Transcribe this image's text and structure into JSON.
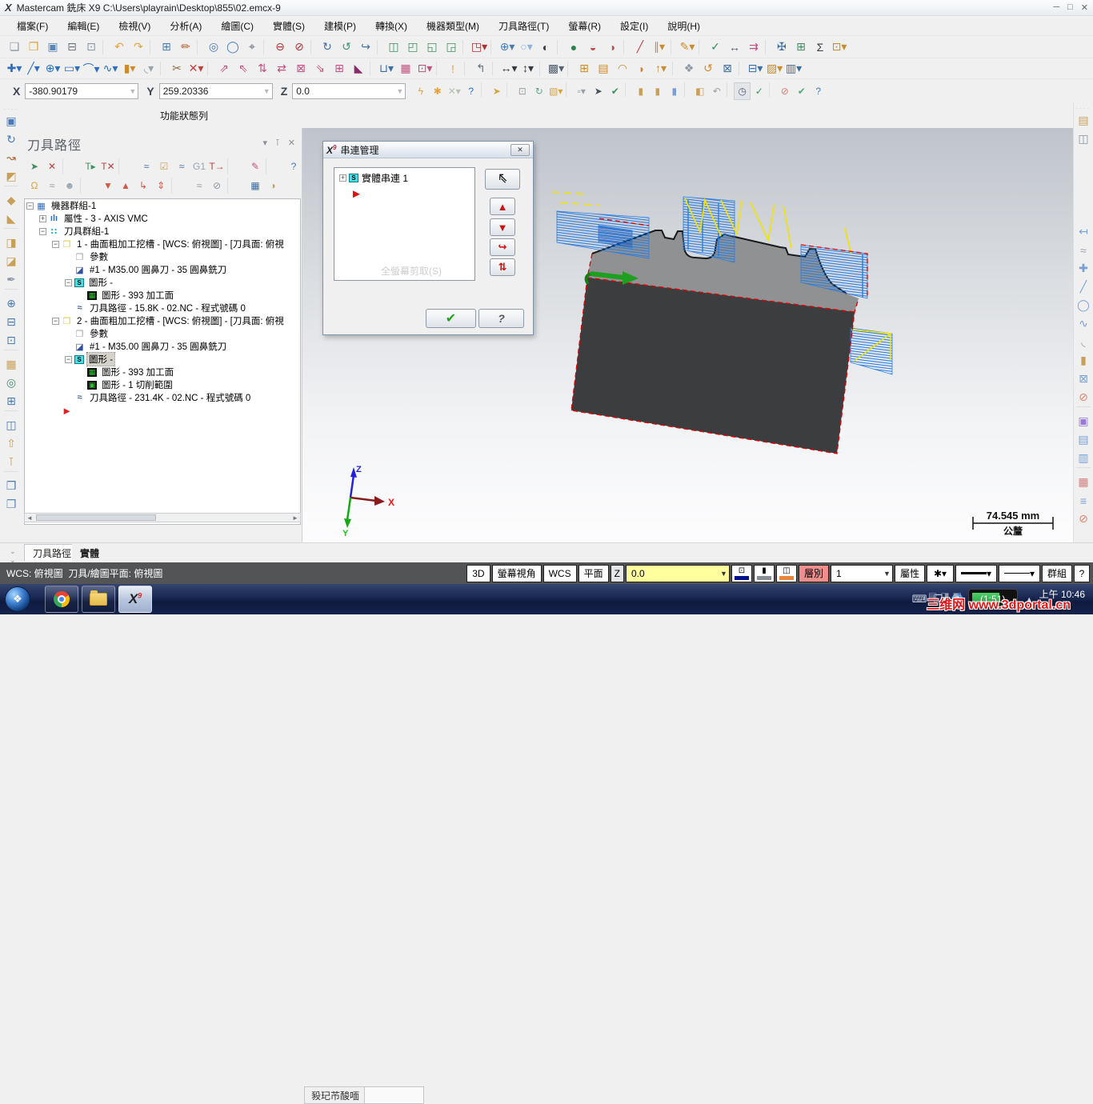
{
  "window": {
    "title": "Mastercam 銑床 X9  C:\\Users\\playrain\\Desktop\\855\\02.emcx-9",
    "logo": "X",
    "controls": {
      "minimize": "─",
      "maximize": "□",
      "close": "✕"
    }
  },
  "menu": {
    "items": [
      {
        "label": "檔案(F)"
      },
      {
        "label": "編輯(E)"
      },
      {
        "label": "檢視(V)"
      },
      {
        "label": "分析(A)"
      },
      {
        "label": "繪圖(C)"
      },
      {
        "label": "實體(S)"
      },
      {
        "label": "建模(P)"
      },
      {
        "label": "轉換(X)"
      },
      {
        "label": "機器類型(M)"
      },
      {
        "label": "刀具路徑(T)"
      },
      {
        "label": "螢幕(R)"
      },
      {
        "label": "設定(I)"
      },
      {
        "label": "說明(H)"
      }
    ]
  },
  "toolbar_row1": [
    {
      "n": "new-file-icon",
      "g": "❏",
      "c": "#8a96a3"
    },
    {
      "n": "open-file-icon",
      "g": "❐",
      "c": "#d9a33c"
    },
    {
      "n": "save-icon",
      "g": "▣",
      "c": "#5b86b5"
    },
    {
      "n": "print-icon",
      "g": "⊟",
      "c": "#6b7480"
    },
    {
      "n": "print-preview-icon",
      "g": "⊡",
      "c": "#8a96a3"
    },
    {
      "t": "sep"
    },
    {
      "n": "undo-icon",
      "g": "↶",
      "c": "#e8a33d"
    },
    {
      "n": "redo-icon",
      "g": "↷",
      "c": "#e8a33d"
    },
    {
      "t": "sep"
    },
    {
      "n": "fit-screen-icon",
      "g": "⊞",
      "c": "#4a7ab5"
    },
    {
      "n": "repaint-icon",
      "g": "✏",
      "c": "#b05a2a"
    },
    {
      "t": "sep"
    },
    {
      "n": "zoom-window-icon",
      "g": "◎",
      "c": "#4a7ab5"
    },
    {
      "n": "zoom-target-icon",
      "g": "◯",
      "c": "#4a7ab5"
    },
    {
      "n": "zoom-select-icon",
      "g": "⌖",
      "c": "#555f69"
    },
    {
      "t": "sep"
    },
    {
      "n": "zoom-out-icon",
      "g": "⊖",
      "c": "#b03030"
    },
    {
      "n": "zoom-out-half-icon",
      "g": "⊘",
      "c": "#b03030"
    },
    {
      "t": "sep"
    },
    {
      "n": "dynamic-rotate-icon",
      "g": "↻",
      "c": "#3e6fa3"
    },
    {
      "n": "rotate-view-icon",
      "g": "↺",
      "c": "#3f8f6f"
    },
    {
      "n": "spin-view-icon",
      "g": "↪",
      "c": "#3e6fa3"
    },
    {
      "t": "sep"
    },
    {
      "n": "isometric-view-icon",
      "g": "◫",
      "c": "#3f8f5f"
    },
    {
      "n": "front-view-icon",
      "g": "◰",
      "c": "#3f8f5f"
    },
    {
      "n": "side-view-icon",
      "g": "◱",
      "c": "#3f8f5f"
    },
    {
      "n": "top-view-icon",
      "g": "◲",
      "c": "#3f8f5f"
    },
    {
      "t": "sep"
    },
    {
      "n": "view-orient-icon",
      "g": "◳▾",
      "c": "#b03030"
    },
    {
      "t": "sep"
    },
    {
      "n": "gview-globe-icon",
      "g": "⊕▾",
      "c": "#4a7ab5"
    },
    {
      "n": "shading-sphere-icon",
      "g": "○▾",
      "c": "#8fb3d9"
    },
    {
      "n": "shading-toggle-icon",
      "g": "◐",
      "c": "#333a42"
    },
    {
      "t": "sep"
    },
    {
      "n": "shade-on-icon",
      "g": "●",
      "c": "#2f7f4f"
    },
    {
      "n": "shade-off-icon",
      "g": "◒",
      "c": "#c05050"
    },
    {
      "n": "translucent-icon",
      "g": "◑",
      "c": "#c05050"
    },
    {
      "t": "sep"
    },
    {
      "n": "wireframe-red-icon",
      "g": "╱",
      "c": "#c04040"
    },
    {
      "n": "wireframe-multi-icon",
      "g": "∥▾",
      "c": "#cc8a2a"
    },
    {
      "t": "sep"
    },
    {
      "n": "attr-pencil-icon",
      "g": "✎▾",
      "c": "#cc8a2a"
    },
    {
      "t": "sep"
    },
    {
      "n": "analyze-entity-icon",
      "g": "✓",
      "c": "#2f8f4f"
    },
    {
      "n": "analyze-distance-icon",
      "g": "↔",
      "c": "#556070"
    },
    {
      "n": "analyze-chain-icon",
      "g": "⇉",
      "c": "#c05080"
    },
    {
      "t": "sep"
    },
    {
      "n": "collision-check-icon",
      "g": "✠",
      "c": "#3e6fa3"
    },
    {
      "n": "regen-doc-icon",
      "g": "⊞",
      "c": "#3f8f5f"
    },
    {
      "n": "sigma-stats-icon",
      "g": "Σ",
      "c": "#333a42"
    },
    {
      "n": "pattern-icon",
      "g": "⊡▾",
      "c": "#cc8a2a"
    }
  ],
  "toolbar_row2": [
    {
      "n": "point-create-icon",
      "g": "✚▾",
      "c": "#2f6fbf"
    },
    {
      "n": "line-create-icon",
      "g": "╱▾",
      "c": "#2f6fbf"
    },
    {
      "n": "arc-create-icon",
      "g": "⊕▾",
      "c": "#2f6fbf"
    },
    {
      "n": "rectangle-create-icon",
      "g": "▭▾",
      "c": "#2f6fbf"
    },
    {
      "n": "fillet-create-icon",
      "g": "⌒▾",
      "c": "#2f6fbf"
    },
    {
      "n": "spline-create-icon",
      "g": "∿▾",
      "c": "#2f6fbf"
    },
    {
      "n": "cylinder-create-icon",
      "g": "▮▾",
      "c": "#cc8a2a"
    },
    {
      "n": "surface-create-icon",
      "g": "◟▾",
      "c": "#9aa4ad"
    },
    {
      "t": "sep"
    },
    {
      "n": "trim-icon",
      "g": "✂",
      "c": "#8a6a3a"
    },
    {
      "n": "trim-break-icon",
      "g": "✕▾",
      "c": "#c04040"
    },
    {
      "t": "sep"
    },
    {
      "n": "xform-translate-icon",
      "g": "⇗",
      "c": "#c05080"
    },
    {
      "n": "xform-translate3d-icon",
      "g": "⇖",
      "c": "#c05080"
    },
    {
      "n": "xform-mirror-icon",
      "g": "⇅",
      "c": "#c05080"
    },
    {
      "n": "xform-rotate-icon",
      "g": "⇄",
      "c": "#c05080"
    },
    {
      "n": "xform-offset-icon",
      "g": "⊠",
      "c": "#c05080"
    },
    {
      "n": "xform-project-icon",
      "g": "⇘",
      "c": "#c05080"
    },
    {
      "n": "xform-array-icon",
      "g": "⊞",
      "c": "#c05080"
    },
    {
      "n": "xform-stretch-icon",
      "g": "◣",
      "c": "#8a2a6a"
    },
    {
      "t": "sep"
    },
    {
      "n": "nesting-icon",
      "g": "⊔▾",
      "c": "#3e6fa3"
    },
    {
      "n": "grid-icon",
      "g": "▦",
      "c": "#c05080"
    },
    {
      "n": "screen-result-icon",
      "g": "⊡▾",
      "c": "#c05080"
    },
    {
      "t": "sep"
    },
    {
      "n": "analyze-flag-icon",
      "g": "!",
      "c": "#e8a33d"
    },
    {
      "t": "sep"
    },
    {
      "n": "jump-corner-icon",
      "g": "↰",
      "c": "#667080"
    },
    {
      "t": "sep"
    },
    {
      "n": "width-dim-icon",
      "g": "↔▾",
      "c": "#333a42"
    },
    {
      "n": "height-dim-icon",
      "g": "↕▾",
      "c": "#333a42"
    },
    {
      "t": "sep"
    },
    {
      "n": "hatch-icon",
      "g": "▩▾",
      "c": "#556070"
    },
    {
      "t": "sep"
    },
    {
      "n": "bounding-box-icon",
      "g": "⊞",
      "c": "#cc8a2a"
    },
    {
      "n": "table-icon",
      "g": "▤",
      "c": "#cc8a2a"
    },
    {
      "n": "dome-icon",
      "g": "◠",
      "c": "#cc8a2a"
    },
    {
      "n": "shell-icon",
      "g": "◗",
      "c": "#cc8a2a"
    },
    {
      "n": "tool-axis-icon",
      "g": "↑▾",
      "c": "#cc8a2a"
    },
    {
      "t": "sep"
    },
    {
      "n": "multiaxis-link-icon",
      "g": "❖",
      "c": "#8a96a3"
    },
    {
      "n": "multiaxis-rotate-icon",
      "g": "↺",
      "c": "#cc8a2a"
    },
    {
      "n": "multiaxis-cube-icon",
      "g": "⊠",
      "c": "#3e6fa3"
    },
    {
      "t": "sep"
    },
    {
      "n": "holder-icon",
      "g": "⊟▾",
      "c": "#3e6fa3"
    },
    {
      "n": "pattern2-icon",
      "g": "▨▾",
      "c": "#cc8a2a"
    },
    {
      "n": "stock-model-icon",
      "g": "▥▾",
      "c": "#3e6fa3"
    }
  ],
  "coord": {
    "x_label": "X",
    "x_value": "-380.90179",
    "y_label": "Y",
    "y_value": "259.20336",
    "z_label": "Z",
    "z_value": "0.0"
  },
  "coord_icons": [
    {
      "n": "autocursor-icon",
      "g": "ϟ",
      "c": "#e8a33d"
    },
    {
      "n": "autocursor-config-icon",
      "g": "✱",
      "c": "#e8a33d"
    },
    {
      "n": "clear-selection-icon",
      "g": "✕▾",
      "c": "#b8c0ae"
    },
    {
      "n": "gun-help-icon",
      "g": "?",
      "c": "#2f6fbf"
    },
    {
      "t": "sep"
    },
    {
      "n": "select-hand-icon",
      "g": "➤",
      "c": "#d9a33c"
    },
    {
      "t": "sep"
    },
    {
      "n": "select-in-box-icon",
      "g": "⊡",
      "c": "#99a0a8"
    },
    {
      "n": "select-rotate-icon",
      "g": "↻",
      "c": "#6aa08a"
    },
    {
      "n": "select-window-icon",
      "g": "▧▾",
      "c": "#d9a33c"
    },
    {
      "t": "sep"
    },
    {
      "n": "select-dashed-icon",
      "g": "▫▾",
      "c": "#99a0a8"
    },
    {
      "n": "select-cursor-icon",
      "g": "➤",
      "c": "#44505c"
    },
    {
      "n": "select-solid-check-icon",
      "g": "✔",
      "c": "#3f8f5f"
    },
    {
      "t": "sep"
    },
    {
      "n": "select-body-icon",
      "g": "▮",
      "c": "#c8a05a"
    },
    {
      "n": "select-face-icon",
      "g": "▮",
      "c": "#c8a05a"
    },
    {
      "n": "select-edge-icon",
      "g": "▮",
      "c": "#7a9fd4"
    },
    {
      "t": "sep"
    },
    {
      "n": "select-half-icon",
      "g": "◧",
      "c": "#c8a05a"
    },
    {
      "n": "select-undo-icon",
      "g": "↶",
      "c": "#99a0a8"
    },
    {
      "t": "sep"
    },
    {
      "n": "history-clock-icon",
      "g": "◷",
      "c": "#556070",
      "x": "hl"
    },
    {
      "n": "validate-cursor-icon",
      "g": "✓",
      "c": "#3f8f5f"
    },
    {
      "t": "sep"
    },
    {
      "n": "ban-icon",
      "g": "⊘",
      "c": "#d87a6a"
    },
    {
      "n": "ok-icon",
      "g": "✔",
      "c": "#57a773"
    },
    {
      "n": "what-icon",
      "g": "?",
      "c": "#4a7ab5"
    }
  ],
  "func_label": "功能狀態列",
  "left_toolbar": [
    {
      "n": "solid-extrude-icon",
      "g": "▣",
      "c": "#4a7ab5"
    },
    {
      "n": "solid-revolve-icon",
      "g": "↻",
      "c": "#4a7ab5"
    },
    {
      "n": "solid-sweep-icon",
      "g": "↝",
      "c": "#b05a2a"
    },
    {
      "n": "solid-loft-icon",
      "g": "◩",
      "c": "#c8a05a"
    },
    {
      "t": "sep"
    },
    {
      "n": "solid-fillet-icon",
      "g": "◆",
      "c": "#c8a05a"
    },
    {
      "n": "solid-chamfer-icon",
      "g": "◣",
      "c": "#c8a05a"
    },
    {
      "t": "sep"
    },
    {
      "n": "solid-shell-icon",
      "g": "◨",
      "c": "#c8a05a"
    },
    {
      "n": "solid-boss-icon",
      "g": "◪",
      "c": "#c8a05a"
    },
    {
      "n": "solid-draft-icon",
      "g": "✒",
      "c": "#8a96a3"
    },
    {
      "t": "sep"
    },
    {
      "n": "solid-boolean-add-icon",
      "g": "⊕",
      "c": "#4a7ab5"
    },
    {
      "n": "solid-boolean-cut-icon",
      "g": "⊟",
      "c": "#4a7ab5"
    },
    {
      "n": "solid-nodes-icon",
      "g": "⊡",
      "c": "#4a7ab5"
    },
    {
      "t": "sep"
    },
    {
      "n": "solid-dice-icon",
      "g": "▦",
      "c": "#c8a05a"
    },
    {
      "n": "solid-find-icon",
      "g": "◎",
      "c": "#3f8f6f"
    },
    {
      "n": "solid-manager-icon",
      "g": "⊞",
      "c": "#4a7ab5"
    },
    {
      "t": "sep"
    },
    {
      "n": "quad-select-icon",
      "g": "◫",
      "c": "#4a7ab5"
    },
    {
      "n": "solid-up-icon",
      "g": "⇧",
      "c": "#c8a05a"
    },
    {
      "n": "solid-pin-icon",
      "g": "⊺",
      "c": "#c8a05a"
    },
    {
      "t": "sep"
    },
    {
      "n": "book-red-icon",
      "g": "❒",
      "c": "#4a7ab5"
    },
    {
      "n": "book-yellow-icon",
      "g": "❒",
      "c": "#5b86b5"
    }
  ],
  "panel": {
    "title": "刀具路徑",
    "header_icons": [
      {
        "n": "panel-menu-icon",
        "g": "▾"
      },
      {
        "n": "panel-pin-icon",
        "g": "⊺"
      },
      {
        "n": "panel-close-icon",
        "g": "✕"
      }
    ],
    "toolbar1": [
      {
        "n": "select-all-ops-icon",
        "g": "➤",
        "c": "#3f8f5f"
      },
      {
        "n": "unselect-all-ops-icon",
        "g": "✕",
        "c": "#c04040"
      },
      {
        "t": "sep"
      },
      {
        "n": "regen-all-icon",
        "g": "T▸",
        "c": "#3f8f5f"
      },
      {
        "n": "regen-selected-icon",
        "g": "T✕",
        "c": "#c04040"
      },
      {
        "t": "sep"
      },
      {
        "n": "backplot-icon",
        "g": "≈",
        "c": "#3e6fa3"
      },
      {
        "n": "verify-icon",
        "g": "☑",
        "c": "#c8a05a"
      },
      {
        "n": "toolpath-options-icon",
        "g": "≈",
        "c": "#3e6fa3"
      },
      {
        "n": "g1-icon",
        "g": "G1",
        "c": "#9aa4ad"
      },
      {
        "n": "post-icon",
        "g": "T→",
        "c": "#c04040"
      },
      {
        "t": "sep"
      },
      {
        "n": "highfeed-icon",
        "g": "✎",
        "c": "#c05080"
      },
      {
        "t": "sep"
      },
      {
        "n": "panel-help-icon",
        "g": "?",
        "c": "#4a7ab5"
      }
    ],
    "toolbar2": [
      {
        "n": "lock-icon",
        "g": "Ω",
        "c": "#d9a33c"
      },
      {
        "n": "toolpath-display-icon",
        "g": "≈",
        "c": "#8a96a3"
      },
      {
        "n": "ghost-icon",
        "g": "☻",
        "c": "#9aa4ad"
      },
      {
        "t": "sep"
      },
      {
        "n": "move-down-icon",
        "g": "▼",
        "c": "#d05a4a"
      },
      {
        "n": "move-up-icon",
        "g": "▲",
        "c": "#d05a4a"
      },
      {
        "n": "insert-arrow-icon",
        "g": "↳",
        "c": "#d05a4a"
      },
      {
        "n": "scroll-insert-icon",
        "g": "⇕",
        "c": "#d05a4a"
      },
      {
        "t": "sep"
      },
      {
        "n": "trim-toolpath-icon",
        "g": "≈",
        "c": "#8a96a3"
      },
      {
        "n": "no-post-icon",
        "g": "⊘",
        "c": "#8a96a3"
      },
      {
        "t": "sep"
      },
      {
        "n": "heavy-grid-icon",
        "g": "▦",
        "c": "#3e6fa3"
      },
      {
        "n": "shade-toggle2-icon",
        "g": "◑",
        "c": "#c8a05a"
      }
    ],
    "tree": [
      {
        "lvl": 0,
        "exp": "−",
        "ic": "ti-plain",
        "ig": "▦",
        "icc": "#2f6fbf",
        "label": "機器群組-1"
      },
      {
        "lvl": 1,
        "exp": "+",
        "ic": "ti-plain",
        "ig": "ılı",
        "icc": "#2f6fbf",
        "label": "屬性 - 3 - AXIS VMC"
      },
      {
        "lvl": 1,
        "exp": "−",
        "ic": "ti-plain",
        "ig": "∷",
        "icc": "#18b8c8",
        "label": "刀具群組-1"
      },
      {
        "lvl": 2,
        "exp": "−",
        "ic": "ti-plain",
        "ig": "❐",
        "icc": "#e8c53d",
        "label": "1 - 曲面粗加工挖槽 - [WCS: 俯視圖] - [刀具面: 俯視"
      },
      {
        "lvl": 3,
        "exp": "",
        "ic": "ti-plain",
        "ig": "❐",
        "icc": "#9aa4ad",
        "label": "參數"
      },
      {
        "lvl": 3,
        "exp": "",
        "ic": "ti-plain",
        "ig": "◪",
        "icc": "#2f4f9f",
        "label": "#1 - M35.00 圓鼻刀 - 35 圓鼻銑刀"
      },
      {
        "lvl": 3,
        "exp": "−",
        "ic": "ti-s",
        "ig": "S",
        "icc": "#000000",
        "label": "圖形 -"
      },
      {
        "lvl": 4,
        "exp": "",
        "ic": "ti-grid",
        "ig": "▦",
        "icc": "#2fbf2f",
        "label": "圖形 - 393 加工面"
      },
      {
        "lvl": 3,
        "exp": "",
        "ic": "ti-plain",
        "ig": "≈",
        "icc": "#3e6fa3",
        "label": "刀具路徑 - 15.8K - 02.NC - 程式號碼 0"
      },
      {
        "lvl": 2,
        "exp": "−",
        "ic": "ti-plain",
        "ig": "❐",
        "icc": "#e8c53d",
        "label": "2 - 曲面粗加工挖槽 - [WCS: 俯視圖] - [刀具面: 俯視"
      },
      {
        "lvl": 3,
        "exp": "",
        "ic": "ti-plain",
        "ig": "❐",
        "icc": "#9aa4ad",
        "label": "參數"
      },
      {
        "lvl": 3,
        "exp": "",
        "ic": "ti-plain",
        "ig": "◪",
        "icc": "#2f4f9f",
        "label": "#1 - M35.00 圓鼻刀 - 35 圓鼻銑刀"
      },
      {
        "lvl": 3,
        "exp": "−",
        "ic": "ti-s",
        "ig": "S",
        "icc": "#000000",
        "label": "圖形 -",
        "sel": "sel"
      },
      {
        "lvl": 4,
        "exp": "",
        "ic": "ti-grid",
        "ig": "▦",
        "icc": "#2fbf2f",
        "label": "圖形 - 393 加工面"
      },
      {
        "lvl": 4,
        "exp": "",
        "ic": "ti-grid",
        "ig": "▣",
        "icc": "#2fbf2f",
        "label": "圖形 - 1 切削範圍"
      },
      {
        "lvl": 3,
        "exp": "",
        "ic": "ti-plain",
        "ig": "≈",
        "icc": "#3e6fa3",
        "label": "刀具路徑 - 231.4K - 02.NC - 程式號碼 0"
      },
      {
        "lvl": 2,
        "exp": "",
        "ic": "ti-arrow",
        "ig": "►",
        "icc": "#e02020",
        "label": ""
      }
    ],
    "tabs": [
      {
        "label": "刀具路徑",
        "cls": "active"
      },
      {
        "label": "實體",
        "cls": "bold"
      }
    ]
  },
  "dialog": {
    "title": "串連管理",
    "logo": "X",
    "logo_sup": "9",
    "item": {
      "exp": "+",
      "icon": "S",
      "label": "實體串連 1"
    },
    "ghost_text": "全螢幕剪取(S)",
    "buttons": {
      "pick": "↖",
      "move_up": "▲",
      "move_down": "▼",
      "rechain": "↪",
      "sort": "⇅",
      "ok": "✔",
      "help": "?"
    }
  },
  "viewport": {
    "gizmo": {
      "x": "X",
      "y": "Y",
      "z": "Z"
    },
    "scale": {
      "value": "74.545 mm",
      "unit": "公釐"
    },
    "bottom_tab": "豛玘芇酸喕"
  },
  "right_toolbar": [
    {
      "n": "qm-result-icon",
      "g": "▤",
      "c": "#c8a05a"
    },
    {
      "n": "qm-wcs-cube-icon",
      "g": "◫",
      "c": "#8a96a3"
    },
    {
      "t": "gap"
    },
    {
      "n": "qm-dimension-icon",
      "g": "↤",
      "c": "#7a9fd4"
    },
    {
      "n": "qm-surface-icon",
      "g": "≈",
      "c": "#9aa4ad"
    },
    {
      "n": "qm-point-icon",
      "g": "✚",
      "c": "#7a9fd4"
    },
    {
      "n": "qm-line-icon",
      "g": "╱",
      "c": "#7a9fd4"
    },
    {
      "n": "qm-arc-icon",
      "g": "◯",
      "c": "#7a9fd4"
    },
    {
      "n": "qm-spline-icon",
      "g": "∿",
      "c": "#7a9fd4"
    },
    {
      "n": "qm-surface2-icon",
      "g": "◟",
      "c": "#9aa4ad"
    },
    {
      "n": "qm-solid-icon",
      "g": "▮",
      "c": "#c8a05a"
    },
    {
      "n": "qm-box-icon",
      "g": "⊠",
      "c": "#7a9fd4"
    },
    {
      "n": "qm-ban-icon",
      "g": "⊘",
      "c": "#e08070"
    },
    {
      "t": "sep"
    },
    {
      "n": "qm-color-icon",
      "g": "▣",
      "c": "#9a7ad4"
    },
    {
      "n": "qm-level-icon",
      "g": "▤",
      "c": "#7a9fd4"
    },
    {
      "n": "qm-level2-icon",
      "g": "▥",
      "c": "#7a9fd4"
    },
    {
      "t": "sep"
    },
    {
      "n": "qm-grid-colors-icon",
      "g": "▦",
      "c": "#d08080"
    },
    {
      "n": "qm-layers-icon",
      "g": "≡",
      "c": "#7a9fd4"
    },
    {
      "n": "qm-ban2-icon",
      "g": "⊘",
      "c": "#e08070"
    }
  ],
  "statusbar": {
    "wcs_text": "WCS: 俯視圖  刀具/繪圖平面: 俯視圖",
    "d3": "3D",
    "screen_view": "螢幕視角",
    "wcs": "WCS",
    "plane": "平面",
    "z_label": "Z",
    "z_value": "0.0",
    "plane_color_glyph": "⊡",
    "wcs_color_glyph": "▮",
    "tool_color_glyph": "◫",
    "plane_color": "#00128b",
    "wcs_color": "#8a8f95",
    "tool_color": "#e8863c",
    "layer_label": "層別",
    "layer_value": "1",
    "attr": "屬性",
    "point_style": "✱",
    "group": "群組",
    "help": "?"
  },
  "taskbar": {
    "start": "❖",
    "battery": "(1:51)",
    "clock": "上午 10:46",
    "watermark": "三维网 www.3dportal.cn",
    "tray_icons": [
      {
        "n": "keyboard-tray-icon",
        "g": "⌨"
      },
      {
        "n": "window-stack-icon",
        "g": "❐▾"
      }
    ]
  }
}
